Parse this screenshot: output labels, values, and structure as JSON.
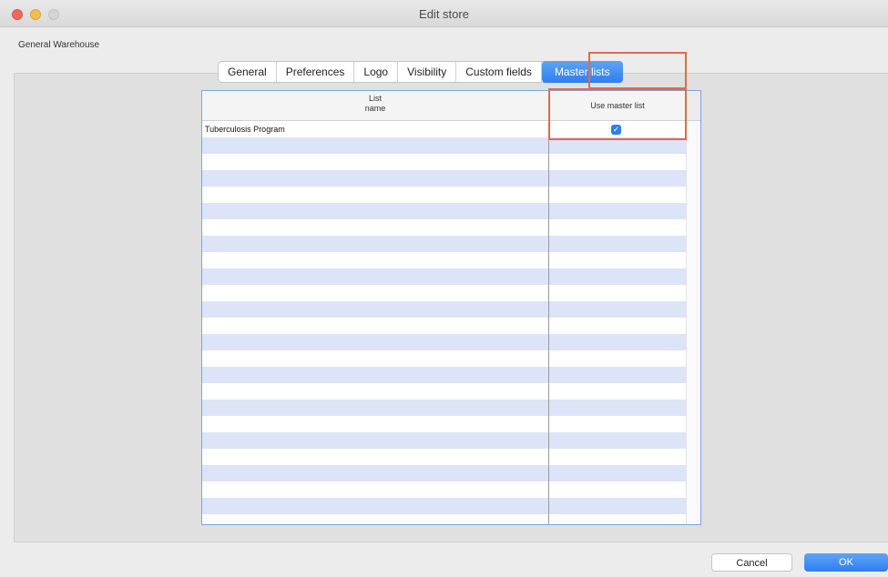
{
  "window": {
    "title": "Edit store"
  },
  "store": {
    "name": "General Warehouse"
  },
  "tabs": [
    {
      "label": "General",
      "active": false
    },
    {
      "label": "Preferences",
      "active": false
    },
    {
      "label": "Logo",
      "active": false
    },
    {
      "label": "Visibility",
      "active": false
    },
    {
      "label": "Custom fields",
      "active": false
    },
    {
      "label": "Master lists",
      "active": true
    }
  ],
  "table": {
    "columns": {
      "name_line1": "List",
      "name_line2": "name",
      "use": "Use master list"
    },
    "rows": [
      {
        "name": "Tuberculosis Program",
        "use_master_list": true
      }
    ],
    "empty_rows": 24
  },
  "buttons": {
    "cancel": "Cancel",
    "ok": "OK"
  },
  "colors": {
    "accent": "#2f7ef0",
    "highlight": "#e06a4e",
    "row_stripe": "#dde4f7"
  }
}
